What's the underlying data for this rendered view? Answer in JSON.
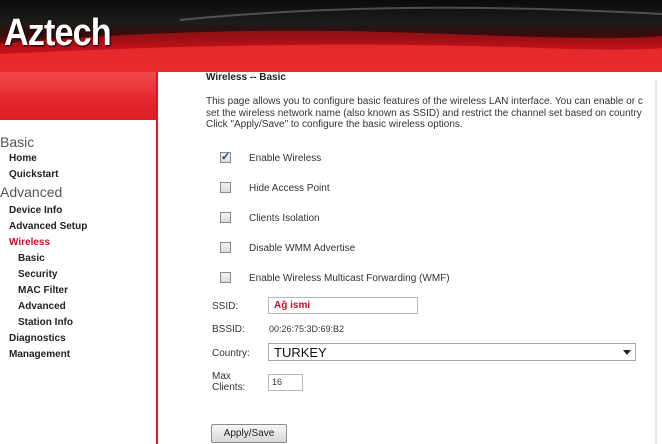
{
  "brand": {
    "logo_text": "Aztech"
  },
  "sidebar": {
    "sections": [
      {
        "label": "Basic"
      },
      {
        "label": "Advanced"
      }
    ],
    "items": [
      {
        "label": "Home"
      },
      {
        "label": "Quickstart"
      },
      {
        "label": "Device Info"
      },
      {
        "label": "Advanced Setup"
      },
      {
        "label": "Wireless"
      },
      {
        "label": "Basic"
      },
      {
        "label": "Security"
      },
      {
        "label": "MAC Filter"
      },
      {
        "label": "Advanced"
      },
      {
        "label": "Station Info"
      },
      {
        "label": "Diagnostics"
      },
      {
        "label": "Management"
      }
    ]
  },
  "main": {
    "title": "Wireless -- Basic",
    "description_lines": [
      "This page allows you to configure basic features of the wireless LAN interface. You can enable or c",
      "set the wireless network name (also known as SSID) and restrict the channel set based on country",
      "Click \"Apply/Save\" to configure the basic wireless options."
    ],
    "options": [
      {
        "label": "Enable Wireless",
        "checked": true
      },
      {
        "label": "Hide Access Point",
        "checked": false
      },
      {
        "label": "Clients Isolation",
        "checked": false
      },
      {
        "label": "Disable WMM Advertise",
        "checked": false
      },
      {
        "label": "Enable Wireless Multicast Forwarding (WMF)",
        "checked": false
      }
    ],
    "ssid": {
      "label": "SSID:",
      "value": "Ağ ismi"
    },
    "bssid": {
      "label": "BSSID:",
      "value": "00:26:75:3D:69:B2"
    },
    "country": {
      "label": "Country:",
      "value": "TURKEY"
    },
    "max_clients": {
      "label_line1": "Max",
      "label_line2": "Clients:",
      "value": "16"
    },
    "apply_label": "Apply/Save"
  },
  "colors": {
    "accent": "#e0171f",
    "active_nav": "#c0102a"
  }
}
